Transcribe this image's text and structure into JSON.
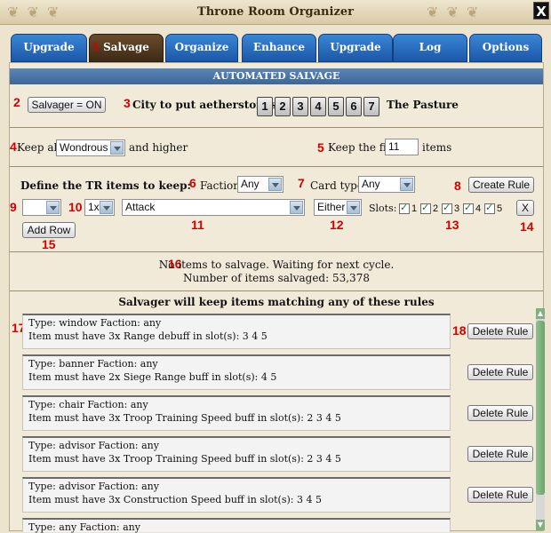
{
  "title": "Throne Room Organizer",
  "close_label": "X",
  "tabs": [
    "Upgrade",
    "Salvage",
    "Organize",
    "Enhance Stats",
    "Upgrade Stats",
    "Log",
    "Options"
  ],
  "header": "AUTOMATED SALVAGE",
  "salvager_button": "Salvager = ON",
  "city_label": "City to put aetherstones:",
  "cities": [
    "1",
    "2",
    "3",
    "4",
    "5",
    "6",
    "7"
  ],
  "city_name": "The Pasture",
  "keep_all_label": "Keep all:",
  "keep_all_value": "Wondrous",
  "and_higher": "and higher",
  "keep_first_label": "Keep the first",
  "keep_first_value": "11",
  "items_label": "items",
  "define_label": "Define the TR items to keep:",
  "faction_label": "Faction:",
  "faction_value": "Any",
  "card_type_label": "Card type:",
  "card_type_value": "Any",
  "create_rule_button": "Create Rule",
  "row": {
    "type_value": "",
    "mult_value": "1x",
    "buff_value": "Attack",
    "either_value": "Either",
    "slots_label": "Slots:",
    "slot_numbers": [
      "1",
      "2",
      "3",
      "4",
      "5"
    ],
    "remove_button": "X"
  },
  "add_row_button": "Add Row",
  "status_line1": "No items to salvage. Waiting for next cycle.",
  "status_line2": "Number of items salvaged: 53,378",
  "rules_heading": "Salvager will keep items matching any of these rules",
  "rules": [
    {
      "line1": "Type: window Faction: any",
      "line2": "Item must have 3x Range debuff in slot(s): 3 4 5"
    },
    {
      "line1": "Type: banner Faction: any",
      "line2": "Item must have 2x Siege Range buff in slot(s): 4 5"
    },
    {
      "line1": "Type: chair Faction: any",
      "line2": "Item must have 3x Troop Training Speed buff in slot(s): 2 3 4 5"
    },
    {
      "line1": "Type: advisor Faction: any",
      "line2": "Item must have 3x Troop Training Speed buff in slot(s): 2 3 4 5"
    },
    {
      "line1": "Type: advisor Faction: any",
      "line2": "Item must have 3x Construction Speed buff in slot(s): 3 4 5"
    },
    {
      "line1": "Type: any Faction: any",
      "line2": ""
    }
  ],
  "delete_rule_label": "Delete Rule",
  "callouts": [
    "1",
    "2",
    "3",
    "4",
    "5",
    "6",
    "7",
    "8",
    "9",
    "10",
    "11",
    "12",
    "13",
    "14",
    "15",
    "16",
    "17",
    "18"
  ]
}
